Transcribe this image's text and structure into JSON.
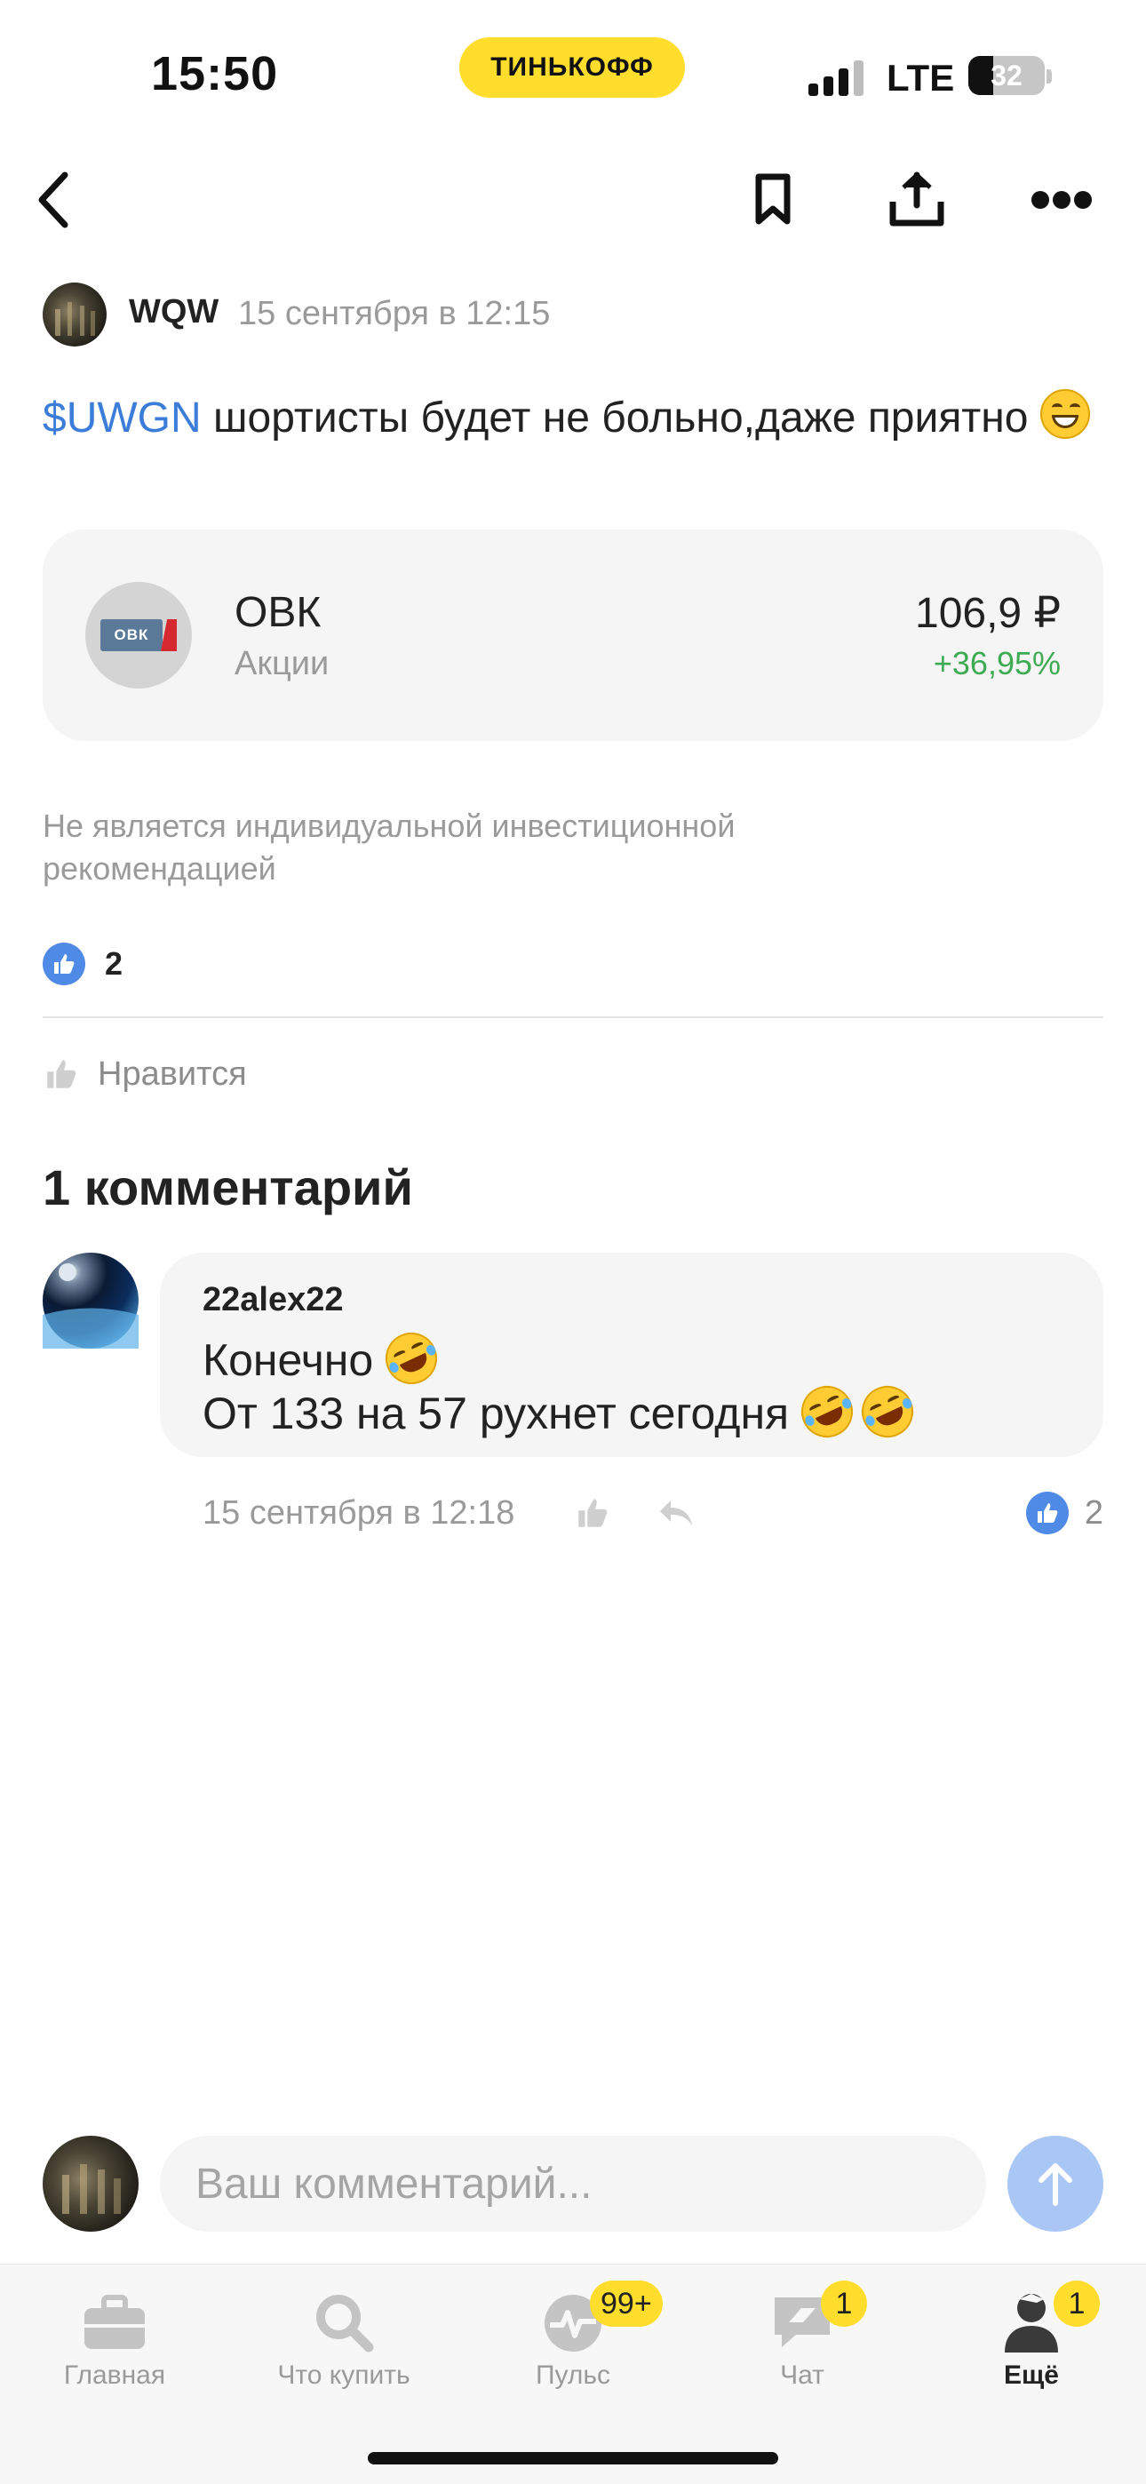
{
  "status_bar": {
    "time": "15:50",
    "carrier_badge": "ТИНЬКОФФ",
    "network": "LTE",
    "battery": "32",
    "battery_level": 0.32
  },
  "nav": {
    "icons": [
      "back-arrow-icon",
      "bookmark-icon",
      "share-icon",
      "more-icon"
    ]
  },
  "post": {
    "author": "WQW",
    "date": "15 сентября в 12:15",
    "ticker": "$UWGN",
    "text": " шортисты будет не больно,даже приятно ",
    "emoji": "grinning-face-emoji",
    "instrument": {
      "logo_text": "ОВК",
      "name": "ОВК",
      "type": "Акции",
      "price": "106,9 ₽",
      "change": "+36,95%",
      "change_color": "#3dab52"
    },
    "disclaimer": "Не является индивидуальной инвестиционной рекомендацией",
    "likes_count": "2",
    "like_action_label": "Нравится"
  },
  "comments": {
    "title": "1 комментарий",
    "items": [
      {
        "author": "22alex22",
        "line1": "Конечно ",
        "line2": "От 133 на 57 рухнет сегодня ",
        "date": "15 сентября в 12:18",
        "likes": "2"
      }
    ]
  },
  "input": {
    "placeholder": "Ваш комментарий...",
    "value": ""
  },
  "tabs": [
    {
      "label": "Главная",
      "icon": "briefcase-icon",
      "badge": ""
    },
    {
      "label": "Что купить",
      "icon": "search-icon",
      "badge": ""
    },
    {
      "label": "Пульс",
      "icon": "pulse-icon",
      "badge": "99+"
    },
    {
      "label": "Чат",
      "icon": "chat-icon",
      "badge": "1"
    },
    {
      "label": "Ещё",
      "icon": "profile-icon",
      "badge": "1"
    }
  ],
  "colors": {
    "accent": "#ffdd2d",
    "link": "#3c7dd9",
    "like": "#4f8be6",
    "positive": "#3dab52"
  }
}
